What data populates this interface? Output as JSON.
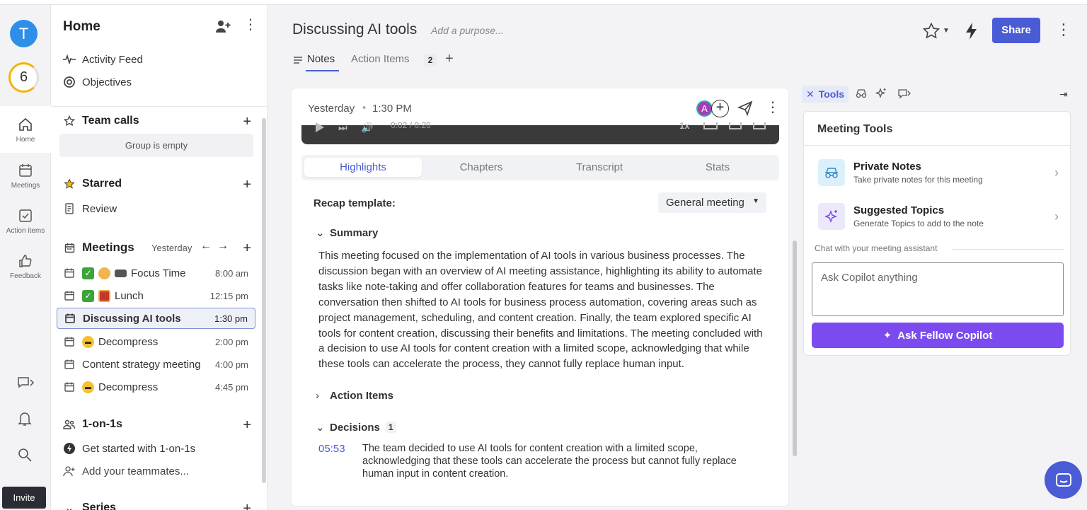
{
  "user": {
    "avatar_initial": "T",
    "score": "6"
  },
  "rail": {
    "items": [
      {
        "label": "Home"
      },
      {
        "label": "Meetings"
      },
      {
        "label": "Action items"
      },
      {
        "label": "Feedback"
      }
    ],
    "invite_label": "Invite"
  },
  "sidebar": {
    "title": "Home",
    "activity_feed": "Activity Feed",
    "objectives": "Objectives",
    "team_calls": "Team calls",
    "group_empty": "Group is empty",
    "starred": "Starred",
    "review": "Review",
    "meetings_label": "Meetings",
    "meetings_day": "Yesterday",
    "meetings": [
      {
        "title": "Focus Time",
        "time": "8:00 am"
      },
      {
        "title": "Lunch",
        "time": "12:15 pm"
      },
      {
        "title": "Discussing AI tools",
        "time": "1:30 pm"
      },
      {
        "title": "Decompress",
        "time": "2:00 pm"
      },
      {
        "title": "Content strategy meeting",
        "time": "4:00 pm"
      },
      {
        "title": "Decompress",
        "time": "4:45 pm"
      }
    ],
    "one_on_ones": "1-on-1s",
    "get_started": "Get started with 1-on-1s",
    "add_teammates": "Add your teammates...",
    "series": "Series"
  },
  "header": {
    "title": "Discussing AI tools",
    "purpose_placeholder": "Add a purpose...",
    "share_label": "Share",
    "tabs": [
      {
        "label": "Notes"
      },
      {
        "label": "Action Items",
        "count": "2"
      }
    ]
  },
  "note": {
    "day": "Yesterday",
    "time": "1:30 PM",
    "participant_initial": "A",
    "player_time": "0:02 / 0:20",
    "player_speed": "1x",
    "subtabs": [
      "Highlights",
      "Chapters",
      "Transcript",
      "Stats"
    ],
    "recap_label": "Recap template:",
    "recap_value": "General meeting",
    "summary_heading": "Summary",
    "summary_text": "This meeting focused on the implementation of AI tools in various business processes. The discussion began with an overview of AI meeting assistance, highlighting its ability to automate tasks like note-taking and offer collaboration features for teams and businesses. The conversation then shifted to AI tools for business process automation, covering areas such as project management, scheduling, and content creation. Finally, the team explored specific AI tools for content creation, discussing their benefits and limitations. The meeting concluded with a decision to use AI tools for content creation with a limited scope, acknowledging that while these tools can accelerate the process, they cannot fully replace human input.",
    "action_items_heading": "Action Items",
    "decisions_heading": "Decisions",
    "decisions_count": "1",
    "decision_time": "05:53",
    "decision_text": "The team decided to use AI tools for content creation with a limited scope, acknowledging that these tools can accelerate the process but cannot fully replace human input in content creation."
  },
  "panel": {
    "tools_tab": "Tools",
    "card_title": "Meeting Tools",
    "private_notes_title": "Private Notes",
    "private_notes_sub": "Take private notes for this meeting",
    "topics_title": "Suggested Topics",
    "topics_sub": "Generate Topics to add to the note",
    "chat_label": "Chat with your meeting assistant",
    "input_placeholder": "Ask Copilot anything",
    "button_label": "Ask Fellow Copilot"
  },
  "colors": {
    "accent": "#4a5bd6",
    "copilot": "#7b4bf0",
    "score_ring": "#f5b400"
  }
}
